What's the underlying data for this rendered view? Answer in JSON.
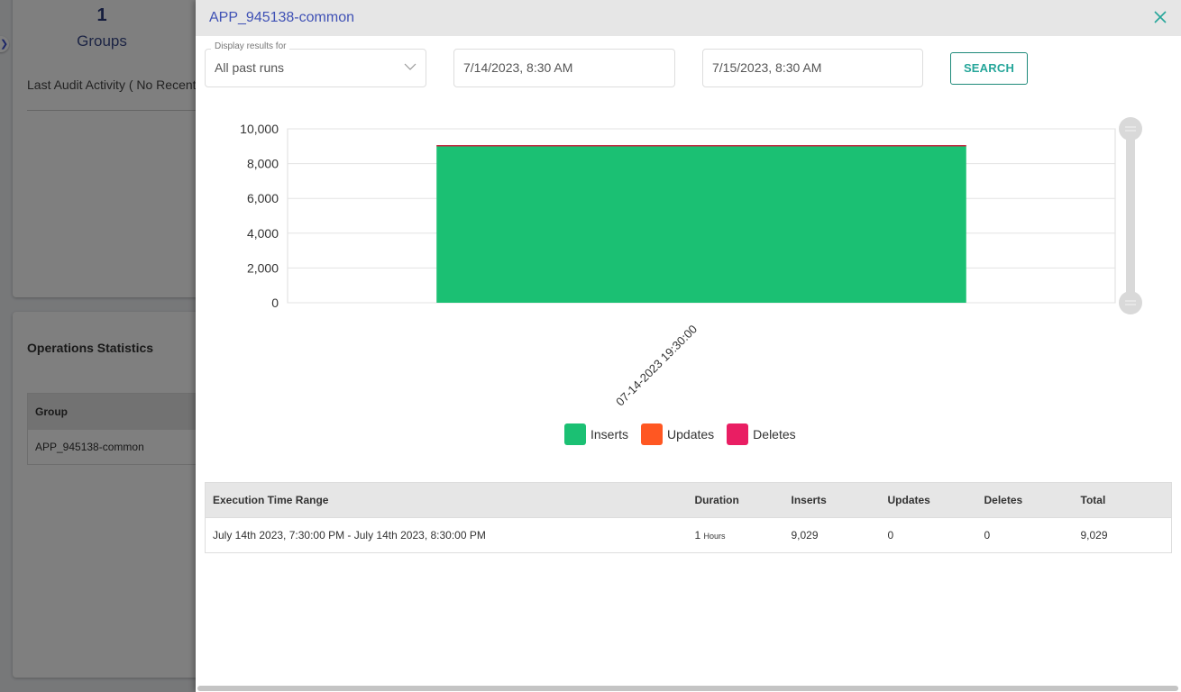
{
  "background": {
    "groups_count": "1",
    "groups_label": "Groups",
    "audit_text": "Last Audit Activity ( No Recent",
    "ops_title": "Operations Statistics",
    "ops_table": {
      "header": "Group",
      "rows": [
        "APP_945138-common"
      ]
    }
  },
  "modal": {
    "title": "APP_945138-common",
    "filter": {
      "legend": "Display results for",
      "selected": "All past runs"
    },
    "from_date": "7/14/2023, 8:30 AM",
    "to_date": "7/15/2023, 8:30 AM",
    "search_label": "SEARCH",
    "colors": {
      "inserts": "#1bc073",
      "updates": "#ff5722",
      "deletes": "#e91e63",
      "accent": "#26a69a",
      "title": "#3f51b5"
    },
    "results": {
      "headers": [
        "Execution Time Range",
        "Duration",
        "Inserts",
        "Updates",
        "Deletes",
        "Total"
      ],
      "rows": [
        {
          "range": "July 14th 2023, 7:30:00 PM - July 14th 2023, 8:30:00 PM",
          "duration_value": "1",
          "duration_unit": "Hours",
          "inserts": "9,029",
          "updates": "0",
          "deletes": "0",
          "total": "9,029"
        }
      ]
    }
  },
  "chart_data": {
    "type": "bar",
    "stacked": true,
    "title": "",
    "xlabel": "",
    "ylabel": "",
    "categories": [
      "07-14-2023 19:30:00"
    ],
    "series": [
      {
        "name": "Inserts",
        "values": [
          9029
        ],
        "color": "#1bc073"
      },
      {
        "name": "Updates",
        "values": [
          0
        ],
        "color": "#ff5722"
      },
      {
        "name": "Deletes",
        "values": [
          0
        ],
        "color": "#e91e63"
      }
    ],
    "ylim": [
      0,
      10000
    ],
    "yticks": [
      0,
      2000,
      4000,
      6000,
      8000,
      10000
    ],
    "ytick_labels": [
      "0",
      "2,000",
      "4,000",
      "6,000",
      "8,000",
      "10,000"
    ],
    "grid": true,
    "legend_position": "bottom"
  }
}
